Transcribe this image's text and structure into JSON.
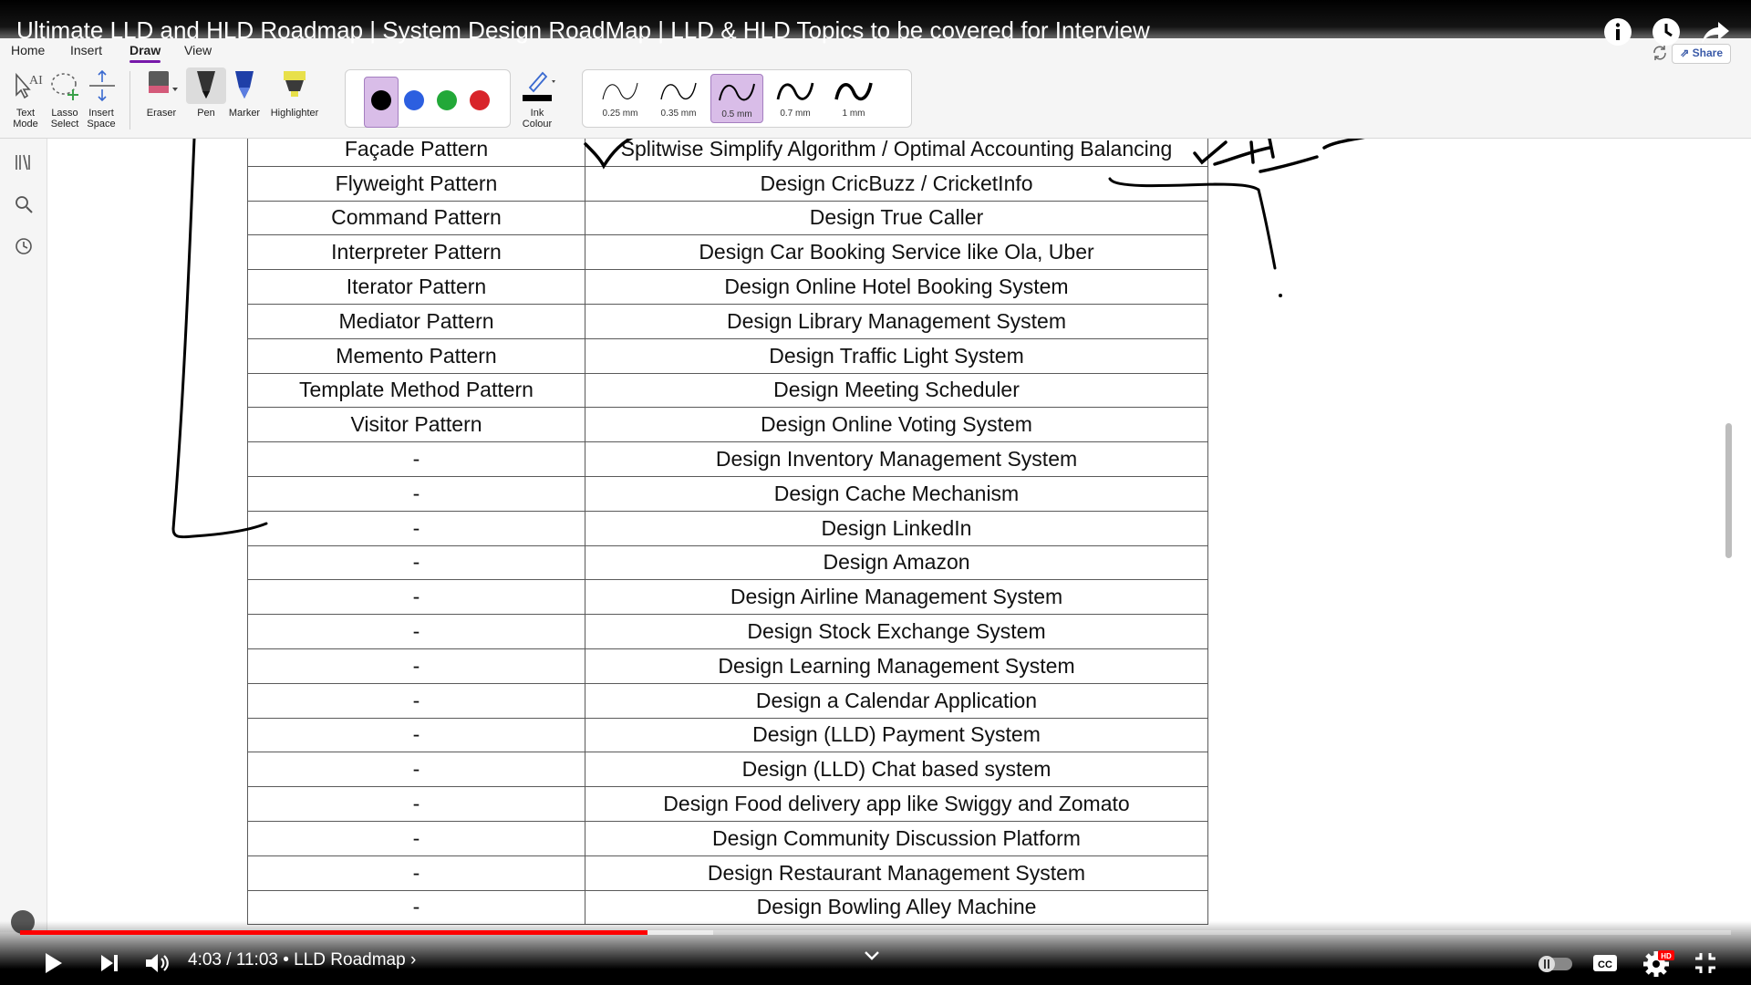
{
  "video": {
    "title": "Ultimate LLD and HLD Roadmap | System Design RoadMap | LLD & HLD Topics to be covered for Interview",
    "time_current": "4:03",
    "time_total": "11:03",
    "time_separator": " / ",
    "chapter": " • LLD Roadmap ›",
    "progress_fraction": 0.3665,
    "buffer_fraction": 0.405
  },
  "ribbon": {
    "tabs": [
      "Home",
      "Insert",
      "Draw",
      "View"
    ],
    "active_tab": "Draw",
    "tools": {
      "text_mode": "Text\nMode",
      "lasso_select": "Lasso\nSelect",
      "insert_space": "Insert\nSpace",
      "eraser": "Eraser",
      "pen": "Pen",
      "marker": "Marker",
      "highlighter": "Highlighter",
      "ink_colour": "Ink\nColour"
    },
    "pen_colors": [
      "#000000",
      "#2c5fe0",
      "#22a838",
      "#d8242a"
    ],
    "selected_color": "#000000",
    "thickness_options": [
      "0.25 mm",
      "0.35 mm",
      "0.5 mm",
      "0.7 mm",
      "1 mm"
    ],
    "selected_thickness": "0.5 mm",
    "share_label": "Share"
  },
  "table": {
    "rows": [
      [
        "Façade Pattern",
        "Splitwise Simplify Algorithm / Optimal Accounting Balancing"
      ],
      [
        "Flyweight Pattern",
        "Design CricBuzz / CricketInfo"
      ],
      [
        "Command Pattern",
        "Design True Caller"
      ],
      [
        "Interpreter Pattern",
        "Design Car Booking Service like Ola, Uber"
      ],
      [
        "Iterator Pattern",
        "Design Online Hotel Booking System"
      ],
      [
        "Mediator Pattern",
        "Design Library Management System"
      ],
      [
        "Memento Pattern",
        "Design  Traffic Light System"
      ],
      [
        "Template Method Pattern",
        "Design Meeting Scheduler"
      ],
      [
        "Visitor Pattern",
        "Design Online Voting System"
      ],
      [
        "-",
        "Design Inventory Management System"
      ],
      [
        "-",
        "Design Cache Mechanism"
      ],
      [
        "-",
        "Design LinkedIn"
      ],
      [
        "-",
        "Design Amazon"
      ],
      [
        "-",
        "Design Airline Management System"
      ],
      [
        "-",
        "Design Stock Exchange System"
      ],
      [
        "-",
        "Design Learning Management System"
      ],
      [
        "-",
        "Design a Calendar Application"
      ],
      [
        "-",
        "Design (LLD) Payment System"
      ],
      [
        "-",
        "Design (LLD) Chat based system"
      ],
      [
        "-",
        "Design Food delivery app like Swiggy and Zomato"
      ],
      [
        "-",
        "Design Community Discussion Platform"
      ],
      [
        "-",
        "Design Restaurant Management System"
      ],
      [
        "-",
        "Design Bowling Alley Machine"
      ]
    ]
  },
  "icons": {
    "info": "info-icon",
    "watch_later": "clock-icon",
    "share": "share-arrow-icon",
    "play": "play-icon",
    "next": "next-icon",
    "volume": "volume-icon",
    "autoplay": "autoplay-toggle-icon",
    "captions": "cc-icon",
    "settings": "settings-gear-icon",
    "fullscreen_exit": "exit-fullscreen-icon"
  }
}
